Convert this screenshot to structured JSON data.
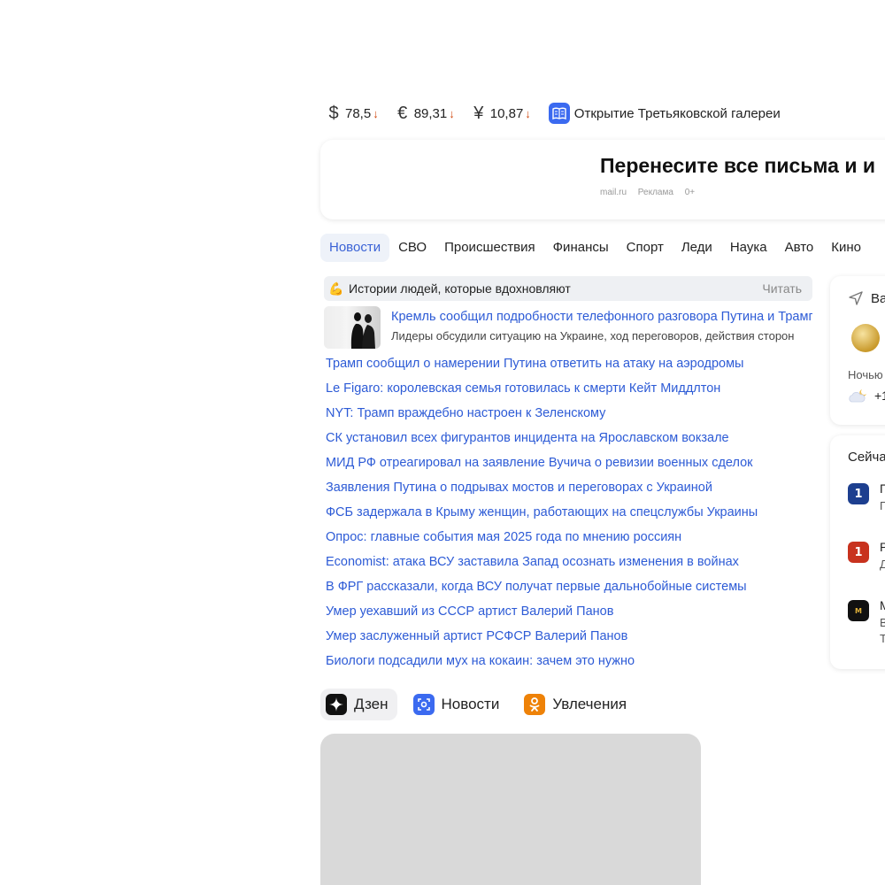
{
  "rates": [
    {
      "symbol": "$",
      "value": "78,5",
      "trend": "down"
    },
    {
      "symbol": "€",
      "value": "89,31",
      "trend": "down"
    },
    {
      "symbol": "¥",
      "value": "10,87",
      "trend": "down"
    }
  ],
  "promo": {
    "label": "Открытие Третьяковской галереи",
    "icon": "book-icon"
  },
  "ad": {
    "title": "Перенесите все письма и и",
    "source": "mail.ru",
    "tag": "Реклама",
    "age": "0+"
  },
  "tabs": [
    {
      "label": "Новости",
      "active": true
    },
    {
      "label": "СВО"
    },
    {
      "label": "Происшествия"
    },
    {
      "label": "Финансы"
    },
    {
      "label": "Спорт"
    },
    {
      "label": "Леди"
    },
    {
      "label": "Наука"
    },
    {
      "label": "Авто"
    },
    {
      "label": "Кино"
    }
  ],
  "story": {
    "emoji": "💪",
    "label": "Истории людей, которые вдохновляют",
    "action": "Читать"
  },
  "lead": {
    "title": "Кремль сообщил подробности телефонного разговора Путина и Трампа",
    "subtitle": "Лидеры обсудили ситуацию на Украине, ход переговоров, действия сторон"
  },
  "news": [
    "Трамп сообщил о намерении Путина ответить на атаку на аэродромы",
    "Le Figaro: королевская семья готовилась к смерти Кейт Миддлтон",
    "NYT: Трамп враждебно настроен к Зеленскому",
    "СК установил всех фигурантов инцидента на Ярославском вокзале",
    "МИД РФ отреагировал на заявление Вучича о ревизии военных сделок",
    "Заявления Путина о подрывах мостов и переговорах с Украиной",
    "ФСБ задержала в Крыму женщин, работающих на спецслужбы Украины",
    "Опрос: главные события мая 2025 года по мнению россиян",
    "Economist: атака ВСУ заставила Запад осознать изменения в войнах",
    "В ФРГ рассказали, когда ВСУ получат первые дальнобойные системы",
    "Умер уехавший из СССР артист Валерий Панов",
    "Умер заслуженный артист РСФСР Валерий Панов",
    "Биологи подсадили мух на кокаин: зачем это нужно"
  ],
  "weather": {
    "location": "Ва",
    "night_label": "Ночью",
    "temp": "+1"
  },
  "tv": {
    "title": "Сейча",
    "channels": [
      {
        "name": "П",
        "program": "П",
        "color": "#1d3f8f",
        "logo": "1"
      },
      {
        "name": "Р",
        "program": "Д",
        "color": "#c8321e",
        "logo": "1"
      },
      {
        "name": "М",
        "program": "В",
        "program2": "Т",
        "color": "#111111",
        "logo": "M"
      }
    ]
  },
  "bottom_tabs": [
    {
      "label": "Дзен",
      "icon": "zen-icon",
      "color": "#111111",
      "active": true
    },
    {
      "label": "Новости",
      "icon": "news-icon",
      "color": "#3b6af0"
    },
    {
      "label": "Увлечения",
      "icon": "ok-icon",
      "color": "#ee8208"
    }
  ]
}
